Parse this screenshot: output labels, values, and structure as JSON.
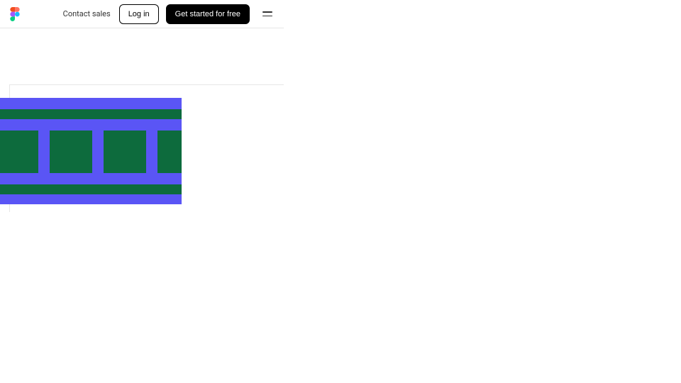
{
  "header": {
    "contact_label": "Contact sales",
    "login_label": "Log in",
    "cta_label": "Get started for free"
  },
  "pattern": {
    "green": "#0d6b3d",
    "purple": "#5a55f5"
  }
}
